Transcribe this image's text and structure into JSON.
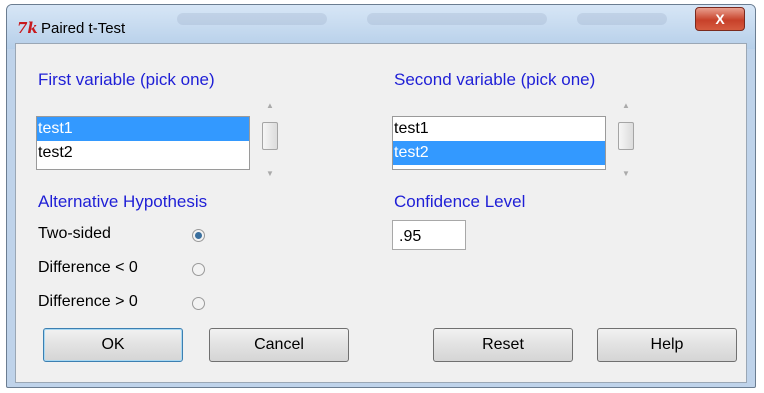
{
  "window": {
    "title": "Paired t-Test",
    "close_label": "X"
  },
  "first_variable": {
    "heading": "First variable (pick one)",
    "items": [
      "test1",
      "test2"
    ],
    "selected": "test1"
  },
  "second_variable": {
    "heading": "Second variable (pick one)",
    "items": [
      "test1",
      "test2"
    ],
    "selected": "test2"
  },
  "alternative": {
    "heading": "Alternative Hypothesis",
    "options": [
      "Two-sided",
      "Difference < 0",
      "Difference > 0"
    ],
    "selected": "Two-sided"
  },
  "confidence": {
    "heading": "Confidence Level",
    "value": ".95"
  },
  "buttons": {
    "ok": "OK",
    "cancel": "Cancel",
    "reset": "Reset",
    "help": "Help"
  },
  "icons": {
    "scroll_up": "scroll-up-arrow-icon",
    "scroll_down": "scroll-down-arrow-icon",
    "app": "tk-logo-icon"
  }
}
